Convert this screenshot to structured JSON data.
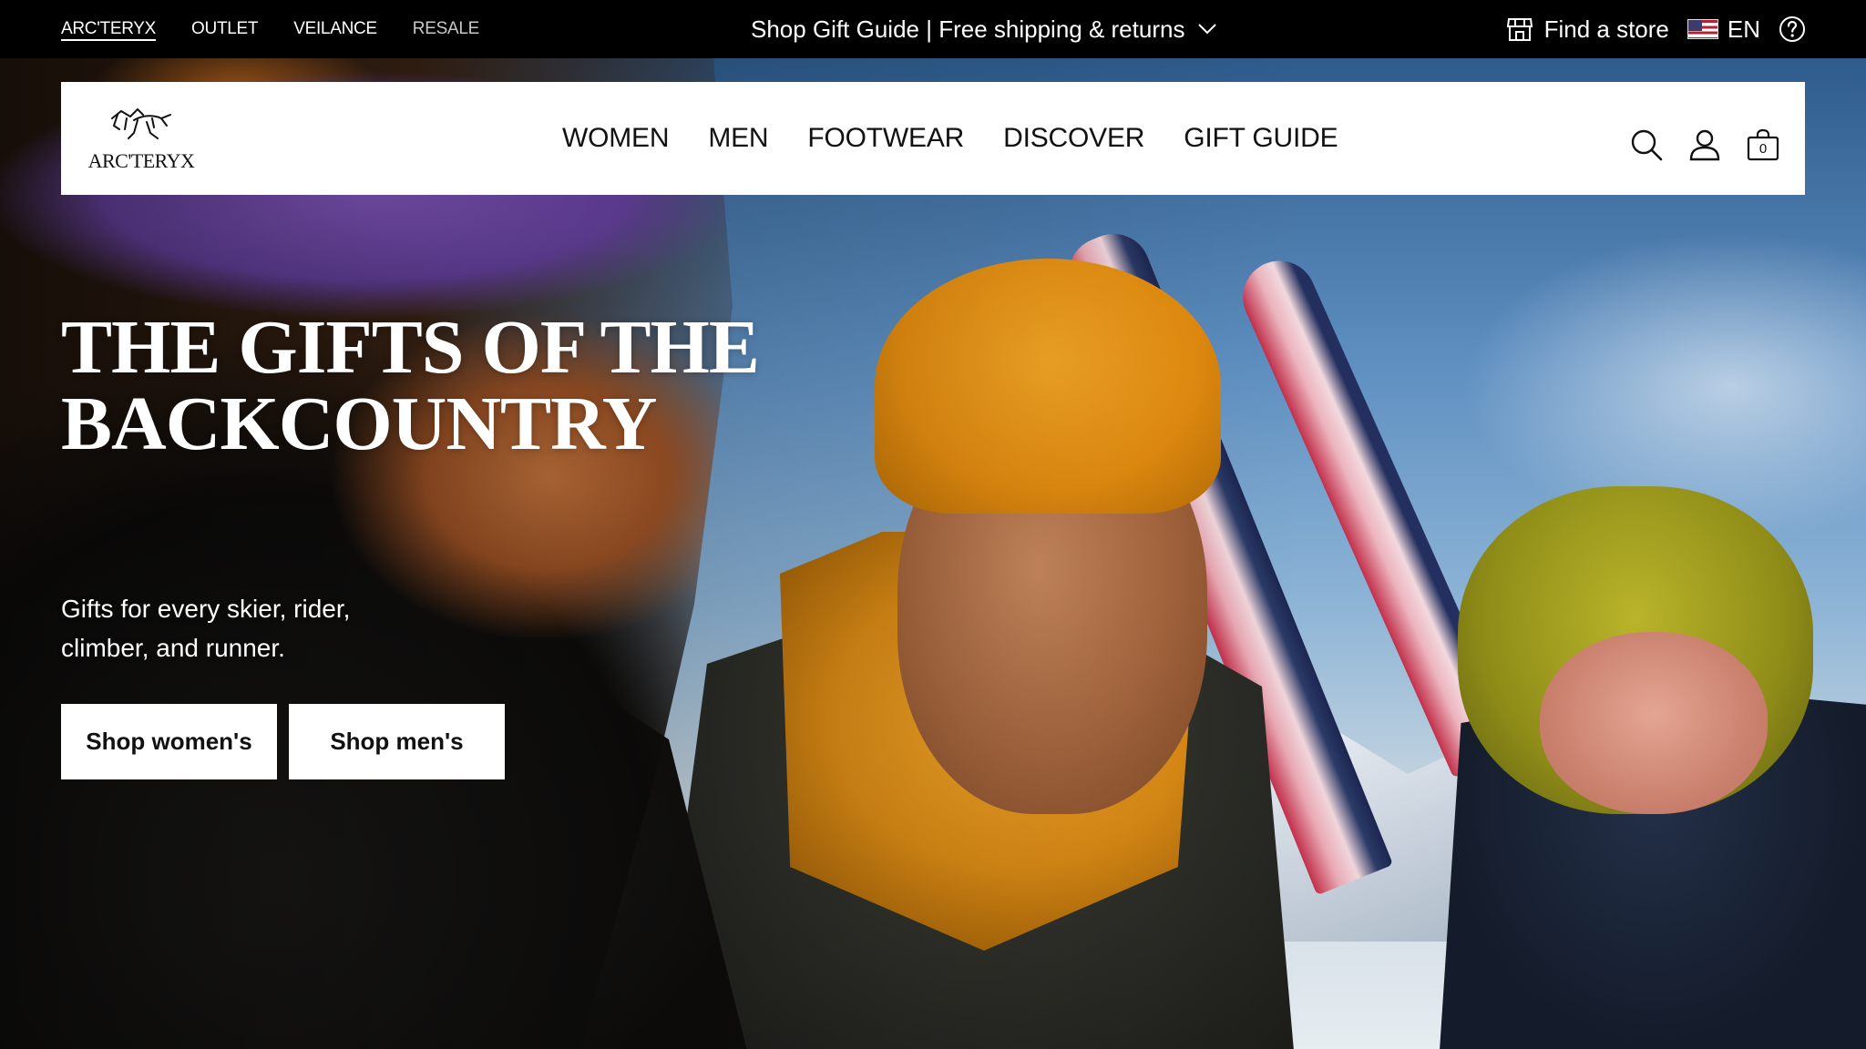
{
  "topbar": {
    "brands": [
      {
        "label": "ARC'TERYX",
        "active": true
      },
      {
        "label": "OUTLET",
        "active": false
      },
      {
        "label": "VEILANCE",
        "active": false
      },
      {
        "label": "RESALE",
        "active": false
      }
    ],
    "promo_text": "Shop Gift Guide | Free shipping & returns",
    "promo_icon": "chevron-down-icon",
    "find_store": "Find a store",
    "store_icon": "storefront-icon",
    "language": "EN",
    "flag_icon": "us-flag-icon",
    "help_icon": "help-icon"
  },
  "nav": {
    "logo_text": "ARC'TERYX",
    "logo_icon": "archaeopteryx-logo-icon",
    "items": [
      "WOMEN",
      "MEN",
      "FOOTWEAR",
      "DISCOVER",
      "GIFT GUIDE"
    ],
    "search_icon": "search-icon",
    "account_icon": "account-icon",
    "cart_icon": "shopping-bag-icon",
    "cart_count": "0"
  },
  "hero": {
    "headline_line1": "THE GIFTS OF THE",
    "headline_line2": "BACKCOUNTRY",
    "subcopy": "Gifts for every skier, rider, climber, and runner.",
    "buttons": [
      "Shop women's",
      "Shop men's"
    ]
  },
  "colors": {
    "topbar_bg": "#000000",
    "nav_bg": "#ffffff",
    "text_dark": "#111111",
    "cta_bg": "#ffffff"
  }
}
